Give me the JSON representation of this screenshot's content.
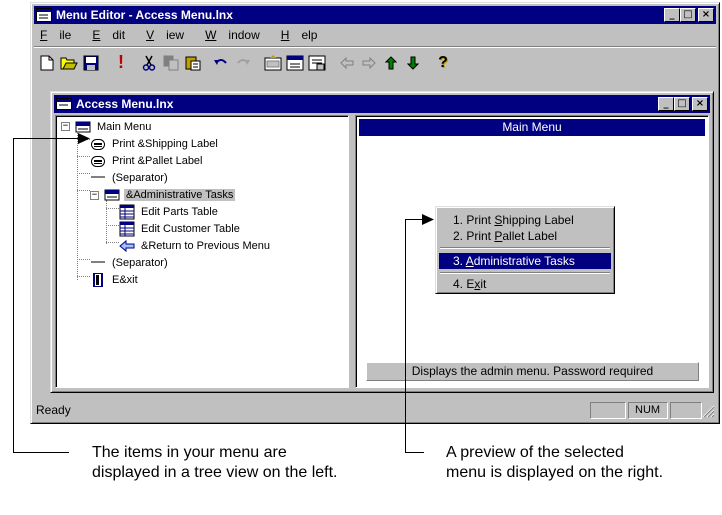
{
  "app": {
    "title": "Menu Editor - Access Menu.lnx",
    "window_buttons": {
      "minimize": "_",
      "maximize": "□",
      "close": "×"
    }
  },
  "menubar": {
    "items": [
      {
        "mnemonic": "F",
        "rest": "ile"
      },
      {
        "mnemonic": "E",
        "rest": "dit"
      },
      {
        "mnemonic": "V",
        "rest": "iew"
      },
      {
        "mnemonic": "W",
        "rest": "indow"
      },
      {
        "mnemonic": "H",
        "rest": "elp"
      }
    ]
  },
  "toolbar": {
    "icons": [
      "new-file-icon",
      "open-folder-icon",
      "save-icon",
      "exclamation-icon",
      "cut-icon",
      "copy-icon",
      "paste-icon",
      "undo-icon",
      "redo-icon",
      "insert-item-icon",
      "insert-submenu-icon",
      "properties-icon",
      "arrow-left-icon",
      "arrow-right-icon",
      "arrow-up-icon",
      "arrow-down-icon",
      "help-icon"
    ],
    "exclamation": "!",
    "help": "?"
  },
  "child": {
    "title": "Access Menu.lnx"
  },
  "tree": {
    "items": [
      {
        "label": "Main Menu"
      },
      {
        "label": "Print &Shipping Label"
      },
      {
        "label": "Print &Pallet Label"
      },
      {
        "label": "(Separator)"
      },
      {
        "label": "&Administrative Tasks"
      },
      {
        "label": "Edit Parts Table"
      },
      {
        "label": "Edit Customer Table"
      },
      {
        "label": "&Return to Previous Menu"
      },
      {
        "label": "(Separator)"
      },
      {
        "label": "E&xit"
      }
    ],
    "expander_collapse": "−"
  },
  "preview": {
    "header": "Main Menu",
    "menu": [
      {
        "pre": "1. Print ",
        "mn": "S",
        "post": "hipping Label"
      },
      {
        "pre": "2. Print ",
        "mn": "P",
        "post": "allet Label"
      },
      {
        "pre": "3. ",
        "mn": "A",
        "post": "dministrative Tasks"
      },
      {
        "pre": "4. E",
        "mn": "x",
        "post": "it"
      }
    ],
    "status": "Displays the admin menu. Password required"
  },
  "statusbar": {
    "ready": "Ready",
    "num": "NUM"
  },
  "captions": {
    "left_line1": "The items in your menu are",
    "left_line2": "displayed in a tree view on the left.",
    "right_line1": "A preview of the selected",
    "right_line2": "menu is displayed on the right."
  }
}
